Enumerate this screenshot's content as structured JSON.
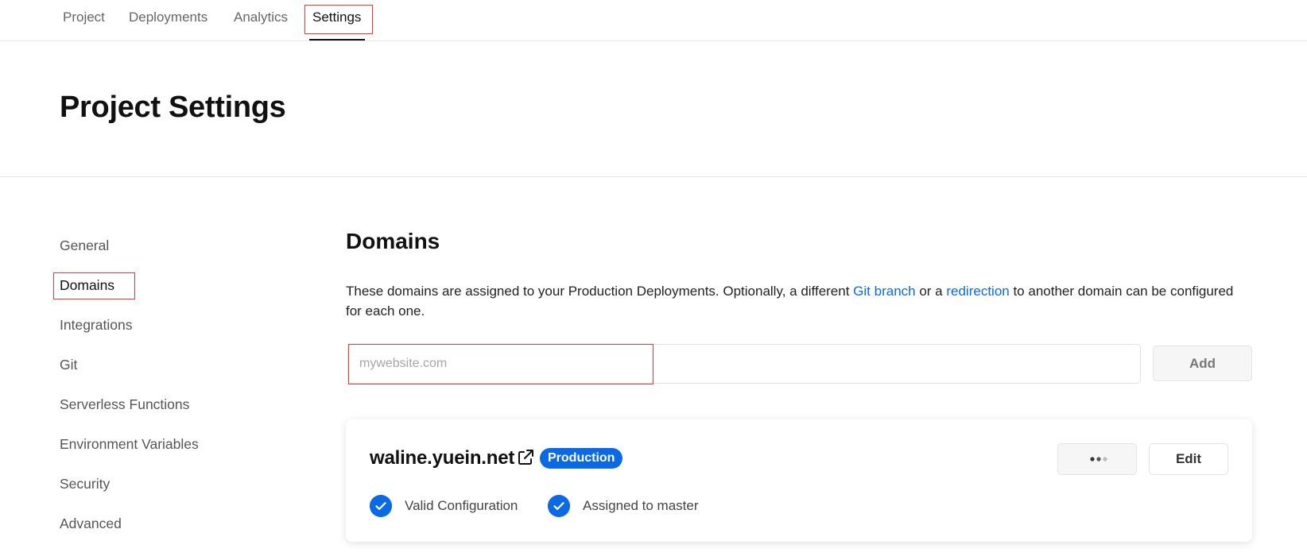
{
  "tabs": [
    {
      "label": "Project"
    },
    {
      "label": "Deployments"
    },
    {
      "label": "Analytics"
    },
    {
      "label": "Settings",
      "active": true
    }
  ],
  "page": {
    "title": "Project Settings"
  },
  "sidebar": {
    "items": [
      {
        "label": "General"
      },
      {
        "label": "Domains",
        "active": true
      },
      {
        "label": "Integrations"
      },
      {
        "label": "Git"
      },
      {
        "label": "Serverless Functions"
      },
      {
        "label": "Environment Variables"
      },
      {
        "label": "Security"
      },
      {
        "label": "Advanced"
      }
    ]
  },
  "domains": {
    "title": "Domains",
    "description_prefix": "These domains are assigned to your Production Deployments. Optionally, a different ",
    "link_git_branch": "Git branch",
    "description_middle": " or a ",
    "link_redirection": "redirection",
    "description_suffix": " to another domain can be configured for each one.",
    "input_placeholder": "mywebsite.com",
    "input_value": "",
    "add_label": "Add",
    "entry": {
      "name": "waline.yuein.net",
      "badge": "Production",
      "edit_label": "Edit",
      "status_valid": "Valid Configuration",
      "status_assigned": "Assigned to master"
    }
  },
  "colors": {
    "accent": "#0a6ae6",
    "highlight_outline": "#e53935"
  },
  "icons": {
    "external_link": "external-link-icon",
    "more": "more-dots-icon",
    "check": "check-circle-icon"
  }
}
